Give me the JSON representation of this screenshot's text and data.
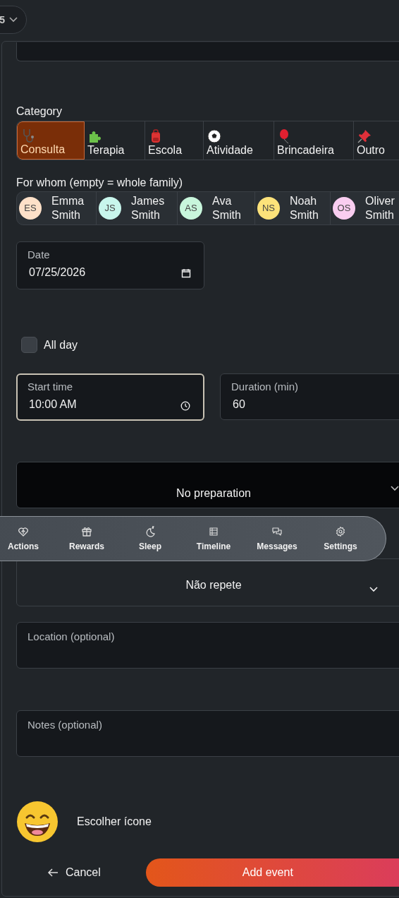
{
  "top_pill": {
    "value": "5"
  },
  "form": {
    "category": {
      "label": "Category",
      "options": [
        {
          "label": "Consulta",
          "selected": true
        },
        {
          "label": "Terapia",
          "selected": false
        },
        {
          "label": "Escola",
          "selected": false
        },
        {
          "label": "Atividade",
          "selected": false
        },
        {
          "label": "Brincadeira",
          "selected": false
        },
        {
          "label": "Outro",
          "selected": false
        }
      ]
    },
    "for_whom": {
      "label": "For whom (empty = whole family)",
      "people": [
        {
          "initials": "ES",
          "first": "Emma",
          "last": "Smith",
          "color": "#fde0c8",
          "selected": false
        },
        {
          "initials": "JS",
          "first": "James",
          "last": "Smith",
          "color": "#c8f6ec",
          "selected": false
        },
        {
          "initials": "AS",
          "first": "Ava",
          "last": "Smith",
          "color": "#c8f6dc",
          "selected": false
        },
        {
          "initials": "NS",
          "first": "Noah",
          "last": "Smith",
          "color": "#fce27a",
          "selected": false
        },
        {
          "initials": "OS",
          "first": "Oliver",
          "last": "Smith",
          "color": "#f9cdf0",
          "selected": false
        }
      ]
    },
    "date": {
      "label": "Date",
      "value": "07/25/2026"
    },
    "all_day": {
      "label": "All day",
      "checked": false
    },
    "start_time": {
      "label": "Start time",
      "value": "10:00 AM",
      "focused": true
    },
    "duration": {
      "label": "Duration (min)",
      "value": "60"
    },
    "preparation": {
      "value": "No preparation"
    },
    "repeat": {
      "value": "Não repete"
    },
    "location": {
      "placeholder": "Location (optional)"
    },
    "notes": {
      "placeholder": "Notes (optional)"
    },
    "icon_picker": {
      "label": "Escolher ícone"
    },
    "cancel": "Cancel",
    "submit": "Add event"
  },
  "nav": [
    {
      "label": "Actions"
    },
    {
      "label": "Rewards"
    },
    {
      "label": "Sleep"
    },
    {
      "label": "Timeline"
    },
    {
      "label": "Messages"
    },
    {
      "label": "Settings"
    }
  ]
}
